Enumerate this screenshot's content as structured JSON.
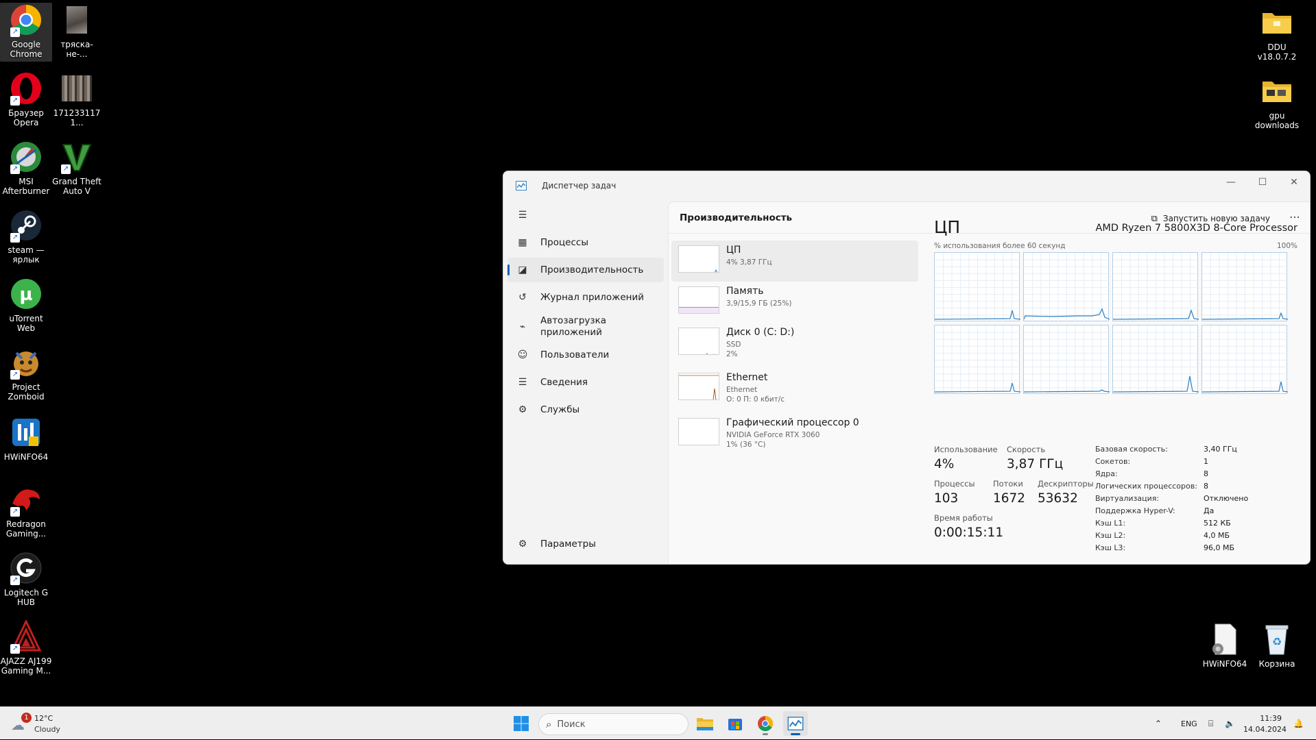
{
  "desktop": {
    "icons_left": [
      {
        "label": "Google Chrome",
        "icon": "chrome-icon"
      },
      {
        "label": "тряска-не-...",
        "icon": "image-thumbnail-icon"
      },
      {
        "label": "Браузер Opera",
        "icon": "opera-icon"
      },
      {
        "label": "1712331171...",
        "icon": "image-thumbnail-icon"
      },
      {
        "label": "MSI Afterburner",
        "icon": "msi-afterburner-icon"
      },
      {
        "label": "Grand Theft Auto V",
        "icon": "gta-v-icon"
      },
      {
        "label": "steam — ярлык",
        "icon": "steam-icon"
      },
      {
        "label": "uTorrent Web",
        "icon": "utorrent-icon"
      },
      {
        "label": "Project Zomboid",
        "icon": "project-zomboid-icon"
      },
      {
        "label": "HWiNFO64",
        "icon": "hwinfo-icon"
      },
      {
        "label": "Redragon Gaming...",
        "icon": "redragon-icon"
      },
      {
        "label": "Logitech G HUB",
        "icon": "logitech-ghub-icon"
      },
      {
        "label": "AJAZZ AJ199 Gaming M...",
        "icon": "ajazz-icon"
      }
    ],
    "icons_right": [
      {
        "label": "DDU v18.0.7.2",
        "icon": "folder-icon"
      },
      {
        "label": "gpu downloads",
        "icon": "folder-icon"
      },
      {
        "label": "HWiNFO64",
        "icon": "hwinfo-file-icon"
      },
      {
        "label": "Корзина",
        "icon": "recycle-bin-icon"
      }
    ]
  },
  "task_manager": {
    "window_title": "Диспетчер задач",
    "nav": [
      {
        "label": "Процессы",
        "icon": "processes-icon"
      },
      {
        "label": "Производительность",
        "icon": "performance-icon",
        "active": true
      },
      {
        "label": "Журнал приложений",
        "icon": "history-icon"
      },
      {
        "label": "Автозагрузка приложений",
        "icon": "startup-icon"
      },
      {
        "label": "Пользователи",
        "icon": "users-icon"
      },
      {
        "label": "Сведения",
        "icon": "details-icon"
      },
      {
        "label": "Службы",
        "icon": "services-icon"
      }
    ],
    "settings_label": "Параметры",
    "page_title": "Производительность",
    "run_new_task": "Запустить новую задачу",
    "devices": [
      {
        "name": "ЦП",
        "sub1": "4% 3,87 ГГц",
        "sub2": "",
        "sub3": ""
      },
      {
        "name": "Память",
        "sub1": "3,9/15,9 ГБ (25%)",
        "sub2": "",
        "sub3": ""
      },
      {
        "name": "Диск 0 (C: D:)",
        "sub1": "SSD",
        "sub2": "2%",
        "sub3": ""
      },
      {
        "name": "Ethernet",
        "sub1": "Ethernet",
        "sub2": "О: 0 П: 0 кбит/с",
        "sub3": ""
      },
      {
        "name": "Графический процессор 0",
        "sub1": "NVIDIA GeForce RTX 3060",
        "sub2": "1% (36 °C)",
        "sub3": ""
      }
    ],
    "cpu": {
      "title": "ЦП",
      "model": "AMD Ryzen 7 5800X3D 8-Core Processor",
      "graph_caption": "% использования более 60 секунд",
      "graph_max": "100%",
      "stats": {
        "usage_label": "Использование",
        "usage_value": "4%",
        "speed_label": "Скорость",
        "speed_value": "3,87 ГГц",
        "processes_label": "Процессы",
        "processes_value": "103",
        "threads_label": "Потоки",
        "threads_value": "1672",
        "handles_label": "Дескрипторы",
        "handles_value": "53632",
        "uptime_label": "Время работы",
        "uptime_value": "0:00:15:11"
      },
      "specs": [
        {
          "key": "Базовая скорость:",
          "value": "3,40 ГГц"
        },
        {
          "key": "Сокетов:",
          "value": "1"
        },
        {
          "key": "Ядра:",
          "value": "8"
        },
        {
          "key": "Логических процессоров:",
          "value": "8"
        },
        {
          "key": "Виртуализация:",
          "value": "Отключено"
        },
        {
          "key": "Поддержка Hyper-V:",
          "value": "Да"
        },
        {
          "key": "Кэш L1:",
          "value": "512 КБ"
        },
        {
          "key": "Кэш L2:",
          "value": "4,0 МБ"
        },
        {
          "key": "Кэш L3:",
          "value": "96,0 МБ"
        }
      ],
      "core_graphs": 8
    }
  },
  "taskbar": {
    "weather_temp": "12°C",
    "weather_desc": "Cloudy",
    "weather_badge": "1",
    "search_placeholder": "Поиск",
    "language": "ENG",
    "time": "11:39",
    "date": "14.04.2024"
  },
  "colors": {
    "accent": "#005fb8",
    "graph_line": "#2f7fc1",
    "memory_line": "#8b2fbf",
    "disk_line": "#4aa33a",
    "ethernet_line": "#a85a1e"
  }
}
